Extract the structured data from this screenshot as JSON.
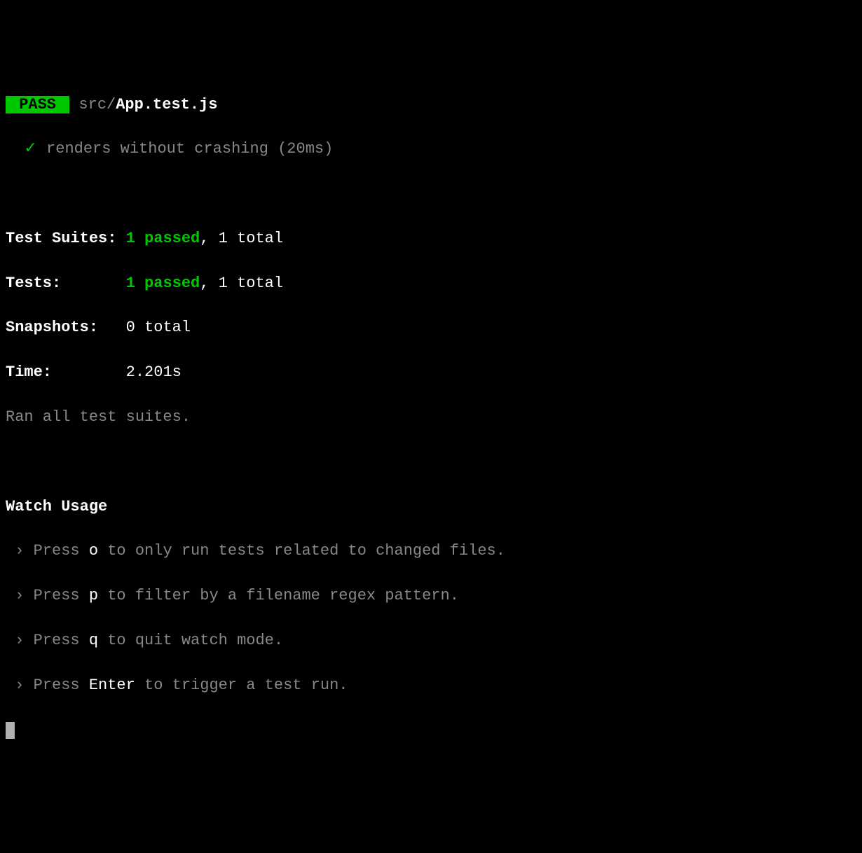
{
  "header": {
    "pass_badge": " PASS ",
    "file_dir": " src/",
    "file_name": "App.test.js"
  },
  "test_result": {
    "checkmark": "✓",
    "description": "renders without crashing (20ms)"
  },
  "summary": {
    "test_suites_label": "Test Suites:",
    "test_suites_passed": "1 passed",
    "test_suites_total": "1 total",
    "tests_label": "Tests:",
    "tests_passed": "1 passed",
    "tests_total": "1 total",
    "snapshots_label": "Snapshots:",
    "snapshots_value": "0 total",
    "time_label": "Time:",
    "time_value": "2.201s",
    "ran_message": "Ran all test suites."
  },
  "watch": {
    "header": "Watch Usage",
    "arrow": " › ",
    "press": "Press ",
    "items": [
      {
        "key": "o",
        "desc": " to only run tests related to changed files."
      },
      {
        "key": "p",
        "desc": " to filter by a filename regex pattern."
      },
      {
        "key": "q",
        "desc": " to quit watch mode."
      },
      {
        "key": "Enter",
        "desc": " to trigger a test run."
      }
    ]
  },
  "sep_comma": ", "
}
